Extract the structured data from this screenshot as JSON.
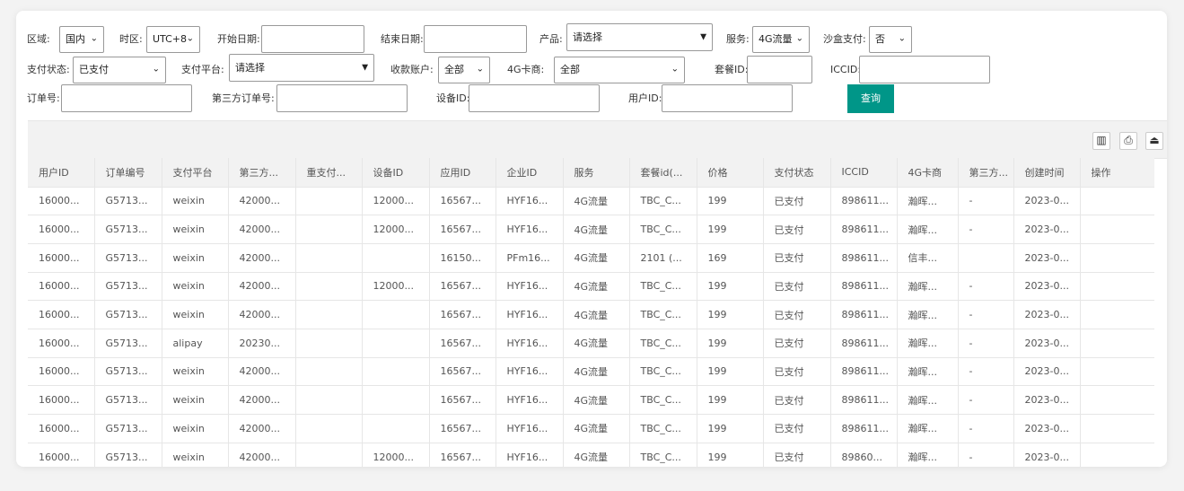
{
  "filters": {
    "region": {
      "label": "区域:",
      "value": "国内"
    },
    "timezone": {
      "label": "时区:",
      "value": "UTC+8"
    },
    "start_date": {
      "label": "开始日期:",
      "value": ""
    },
    "end_date": {
      "label": "结束日期:",
      "value": ""
    },
    "product": {
      "label": "产品:",
      "value": "请选择"
    },
    "service": {
      "label": "服务:",
      "value": "4G流量"
    },
    "sandbox_pay": {
      "label": "沙盒支付:",
      "value": "否"
    },
    "pay_status": {
      "label": "支付状态:",
      "value": "已支付"
    },
    "pay_platform": {
      "label": "支付平台:",
      "value": "请选择"
    },
    "payee_account": {
      "label": "收款账户:",
      "value": "全部"
    },
    "carrier_4g": {
      "label": "4G卡商:",
      "value": "全部"
    },
    "package_id": {
      "label": "套餐ID:",
      "value": ""
    },
    "iccid": {
      "label": "ICCID:",
      "value": ""
    },
    "order_no": {
      "label": "订单号:",
      "value": ""
    },
    "third_order_no": {
      "label": "第三方订单号:",
      "value": ""
    },
    "device_id": {
      "label": "设备ID:",
      "value": ""
    },
    "user_id": {
      "label": "用户ID:",
      "value": ""
    },
    "query_button": "查询"
  },
  "toolbar": {
    "icons": [
      "columns-icon",
      "print-icon",
      "export-icon"
    ],
    "glyphs": [
      "▥",
      "⎙",
      "⏏"
    ]
  },
  "table": {
    "columns": [
      "用户ID",
      "订单编号",
      "支付平台",
      "第三方...",
      "重支付...",
      "设备ID",
      "应用ID",
      "企业ID",
      "服务",
      "套餐id(...",
      "价格",
      "支付状态",
      "ICCID",
      "4G卡商",
      "第三方...",
      "创建时间",
      "操作"
    ],
    "rows": [
      [
        "16000...",
        "G5713...",
        "weixin",
        "42000...",
        "",
        "12000...",
        "16567...",
        "HYF16...",
        "4G流量",
        "TBC_C...",
        "199",
        "已支付",
        "898611...",
        "瀚晖...",
        "-",
        "2023-0...",
        ""
      ],
      [
        "16000...",
        "G5713...",
        "weixin",
        "42000...",
        "",
        "12000...",
        "16567...",
        "HYF16...",
        "4G流量",
        "TBC_C...",
        "199",
        "已支付",
        "898611...",
        "瀚晖...",
        "-",
        "2023-0...",
        ""
      ],
      [
        "16000...",
        "G5713...",
        "weixin",
        "42000...",
        "",
        "",
        "16150...",
        "PFm16...",
        "4G流量",
        "2101 (...",
        "169",
        "已支付",
        "898611...",
        "信丰...",
        "",
        "2023-0...",
        ""
      ],
      [
        "16000...",
        "G5713...",
        "weixin",
        "42000...",
        "",
        "12000...",
        "16567...",
        "HYF16...",
        "4G流量",
        "TBC_C...",
        "199",
        "已支付",
        "898611...",
        "瀚晖...",
        "-",
        "2023-0...",
        ""
      ],
      [
        "16000...",
        "G5713...",
        "weixin",
        "42000...",
        "",
        "",
        "16567...",
        "HYF16...",
        "4G流量",
        "TBC_C...",
        "199",
        "已支付",
        "898611...",
        "瀚晖...",
        "-",
        "2023-0...",
        ""
      ],
      [
        "16000...",
        "G5713...",
        "alipay",
        "20230...",
        "",
        "",
        "16567...",
        "HYF16...",
        "4G流量",
        "TBC_C...",
        "199",
        "已支付",
        "898611...",
        "瀚晖...",
        "-",
        "2023-0...",
        ""
      ],
      [
        "16000...",
        "G5713...",
        "weixin",
        "42000...",
        "",
        "",
        "16567...",
        "HYF16...",
        "4G流量",
        "TBC_C...",
        "199",
        "已支付",
        "898611...",
        "瀚晖...",
        "-",
        "2023-0...",
        ""
      ],
      [
        "16000...",
        "G5713...",
        "weixin",
        "42000...",
        "",
        "",
        "16567...",
        "HYF16...",
        "4G流量",
        "TBC_C...",
        "199",
        "已支付",
        "898611...",
        "瀚晖...",
        "-",
        "2023-0...",
        ""
      ],
      [
        "16000...",
        "G5713...",
        "weixin",
        "42000...",
        "",
        "",
        "16567...",
        "HYF16...",
        "4G流量",
        "TBC_C...",
        "199",
        "已支付",
        "898611...",
        "瀚晖...",
        "-",
        "2023-0...",
        ""
      ],
      [
        "16000...",
        "G5713...",
        "weixin",
        "42000...",
        "",
        "12000...",
        "16567...",
        "HYF16...",
        "4G流量",
        "TBC_C...",
        "199",
        "已支付",
        "89860...",
        "瀚晖...",
        "-",
        "2023-0...",
        ""
      ]
    ]
  },
  "colors": {
    "accent": "#009688"
  }
}
